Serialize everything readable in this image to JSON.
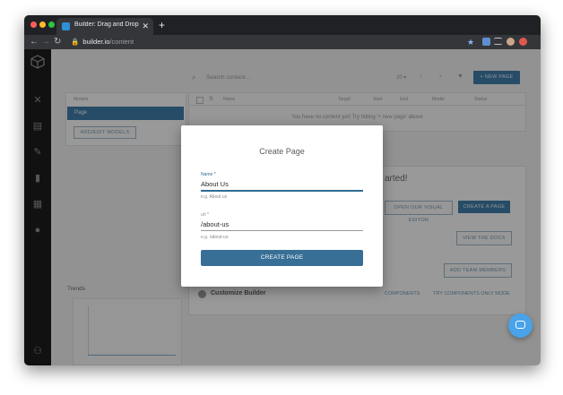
{
  "browser": {
    "tab_title": "Builder: Drag and Drop Page B",
    "tab_close": "✕",
    "new_tab": "+",
    "url_host": "builder.io",
    "url_path": "/content"
  },
  "content_toolbar": {
    "search_placeholder": "Search content...",
    "new_page_button": "+ NEW PAGE"
  },
  "models_panel": {
    "header": "Models",
    "items": [
      "Page"
    ],
    "add_edit_button": "ADD/EDIT MODELS"
  },
  "content_table": {
    "columns": [
      "Name",
      "Target",
      "Start",
      "End",
      "Model",
      "Status"
    ],
    "empty_message": "You have no content yet! Try hitting '+ new page' above"
  },
  "get_started": {
    "title_fragment": "arted!",
    "open_visual_editor": "OPEN OUR VISUAL EDITOR",
    "create_page": "CREATE A PAGE",
    "view_docs": "VIEW THE DOCS",
    "add_team_members": "ADD TEAM MEMBERS",
    "custom_label": "Customize Builder",
    "components_link": "COMPONENTS",
    "try_components": "TRY COMPONENTS ONLY MODE"
  },
  "trends": {
    "title": "Trends"
  },
  "modal": {
    "title": "Create Page",
    "name_label": "Name *",
    "name_value": "About Us",
    "name_hint": "e.g. About us",
    "url_label": "url *",
    "url_value": "/about-us",
    "url_hint": "e.g. /about-us",
    "create_button": "CREATE PAGE"
  },
  "colors": {
    "accent": "#386f96",
    "field_active": "#2f6b95"
  }
}
